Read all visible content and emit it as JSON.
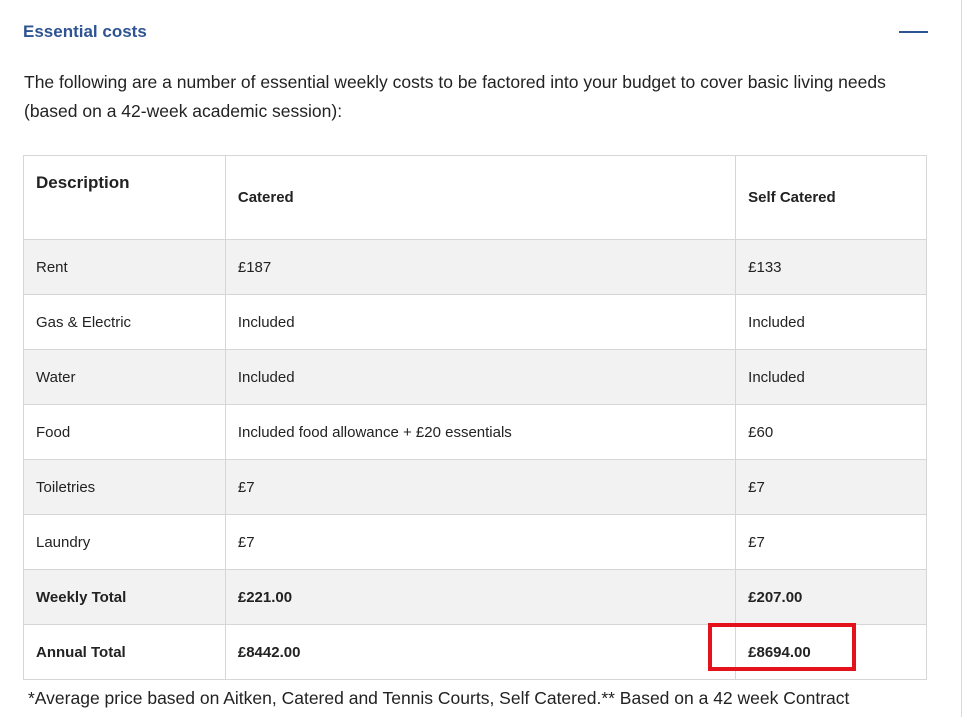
{
  "section": {
    "title": "Essential costs",
    "intro": "The following are a number of essential weekly costs to be factored into your budget to cover basic living needs (based on a 42-week academic session):"
  },
  "table": {
    "headers": {
      "description": "Description",
      "catered": "Catered",
      "self_catered": "Self Catered"
    },
    "rows": [
      {
        "description": "Rent",
        "catered": "£187",
        "self_catered": "£133"
      },
      {
        "description": "Gas & Electric",
        "catered": "Included",
        "self_catered": "Included"
      },
      {
        "description": "Water",
        "catered": "Included",
        "self_catered": "Included"
      },
      {
        "description": "Food",
        "catered": "Included food allowance + £20 essentials",
        "self_catered": "£60"
      },
      {
        "description": "Toiletries",
        "catered": "£7",
        "self_catered": "£7"
      },
      {
        "description": "Laundry",
        "catered": "£7",
        "self_catered": "£7"
      },
      {
        "description": "Weekly Total",
        "catered": "£221.00",
        "self_catered": "£207.00"
      },
      {
        "description": "Annual Total",
        "catered": "£8442.00",
        "self_catered": "£8694.00"
      }
    ]
  },
  "footnote": "*Average price based on Aitken, Catered and Tennis Courts, Self Catered.** Based on a 42 week Contract",
  "colors": {
    "accent": "#2e5492",
    "highlight": "#e3121b",
    "row_alt": "#f2f2f2",
    "border": "#d6d6d6"
  },
  "icons": {
    "collapse": "minus-icon"
  }
}
